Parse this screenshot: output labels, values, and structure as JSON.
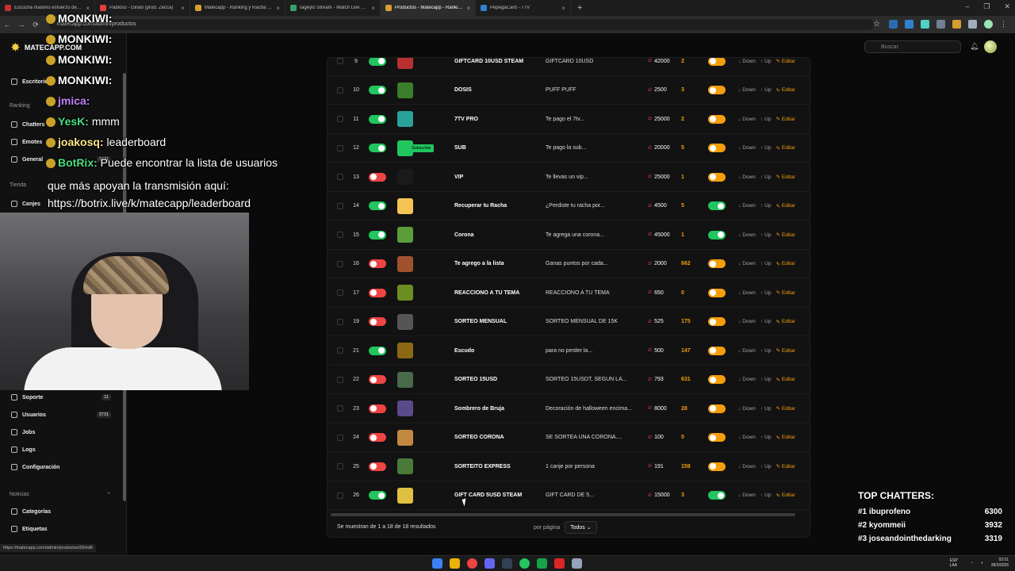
{
  "browser": {
    "tabs": [
      {
        "title": "Escucha maximo esfuerzo de la...",
        "fav": "#c53030",
        "active": false
      },
      {
        "title": "Pabloso - Giralo (prod. Zecca)",
        "fav": "#e53e3e",
        "active": false
      },
      {
        "title": "Matecapp - Ranking y Racha de...",
        "fav": "#d69e2e",
        "active": false
      },
      {
        "title": "rageylo Stream - Watch Live on...",
        "fav": "#38a169",
        "active": false
      },
      {
        "title": "Productos - Matecapp - Ranking...",
        "fav": "#d69e2e",
        "active": true
      },
      {
        "title": "PepegaCard - 7TV",
        "fav": "#3182ce",
        "active": false
      }
    ],
    "new_tab": "+",
    "url": "matecapp.com/admin/productos",
    "window_controls": [
      "–",
      "❐",
      "✕"
    ]
  },
  "sidebar": {
    "logo": "MATECAPP.COM",
    "sections": [
      {
        "label": "Ranking",
        "key": "ranking"
      },
      {
        "label": "Tienda",
        "key": "tienda"
      },
      {
        "label": "Noticias",
        "key": "noticias"
      }
    ],
    "items_top": [
      {
        "label": "Escritorio",
        "badge": ""
      },
      {
        "label": "Chatters",
        "badge": ""
      },
      {
        "label": "Emotes",
        "badge": ""
      },
      {
        "label": "General",
        "badge": "3731"
      },
      {
        "label": "Canjes",
        "badge": ""
      }
    ],
    "items_bottom": [
      {
        "label": "Soporte",
        "badge": "11"
      },
      {
        "label": "Usuarios",
        "badge": "3731"
      },
      {
        "label": "Jobs",
        "badge": ""
      },
      {
        "label": "Logs",
        "badge": ""
      },
      {
        "label": "Configuración",
        "badge": ""
      }
    ],
    "items_news": [
      {
        "label": "Categorías",
        "badge": ""
      },
      {
        "label": "Etiquetas",
        "badge": ""
      }
    ]
  },
  "header": {
    "search_placeholder": "Buscar"
  },
  "table": {
    "rows": [
      {
        "id": "9",
        "active": true,
        "name": "GIFTCARD 10USD STEAM",
        "desc": "GIFTCARD 10USD",
        "cost": "42000",
        "count": "2",
        "visible": false,
        "thumb": "#b83030"
      },
      {
        "id": "10",
        "active": true,
        "name": "DOSIS",
        "desc": "PUFF PUFF",
        "cost": "2500",
        "count": "3",
        "visible": false,
        "thumb": "#3a7d2a"
      },
      {
        "id": "11",
        "active": true,
        "name": "7TV PRO",
        "desc": "Te pago el 7tv...",
        "cost": "25000",
        "count": "2",
        "visible": false,
        "thumb": "#29a39a"
      },
      {
        "id": "12",
        "active": true,
        "name": "SUB",
        "desc": "Te pago la sub...",
        "cost": "20000",
        "count": "5",
        "visible": false,
        "thumb": "#22c55e"
      },
      {
        "id": "13",
        "active": false,
        "name": "VIP",
        "desc": "Te llevas un vip...",
        "cost": "25000",
        "count": "1",
        "visible": false,
        "thumb": "#1a1a1a"
      },
      {
        "id": "14",
        "active": true,
        "name": "Recuperar tu Racha",
        "desc": "¿Perdiste tu racha por...",
        "cost": "4500",
        "count": "5",
        "visible": true,
        "thumb": "#f6c453"
      },
      {
        "id": "15",
        "active": true,
        "name": "Corona",
        "desc": "Te agrega una corona...",
        "cost": "45000",
        "count": "1",
        "visible": true,
        "thumb": "#5a9d3a"
      },
      {
        "id": "16",
        "active": false,
        "name": "Te agrego a la lista",
        "desc": "Ganas puntos por cada...",
        "cost": "2000",
        "count": "662",
        "visible": false,
        "thumb": "#a0522d"
      },
      {
        "id": "17",
        "active": false,
        "name": "REACCIONO A TU TEMA",
        "desc": "REACCIONO A TU TEMA",
        "cost": "650",
        "count": "0",
        "visible": false,
        "thumb": "#6b8e23"
      },
      {
        "id": "19",
        "active": false,
        "name": "SORTEO MENSUAL",
        "desc": "SORTEO MENSUAL DE 15K",
        "cost": "525",
        "count": "175",
        "visible": false,
        "thumb": "#555555"
      },
      {
        "id": "21",
        "active": true,
        "name": "Escudo",
        "desc": "para no perder la...",
        "cost": "500",
        "count": "147",
        "visible": false,
        "thumb": "#8b6914"
      },
      {
        "id": "22",
        "active": false,
        "name": "SORTEO 15USD",
        "desc": "SORTEO 15USDT, SEGUN LA...",
        "cost": "793",
        "count": "631",
        "visible": false,
        "thumb": "#4a6a4a"
      },
      {
        "id": "23",
        "active": false,
        "name": "Sombrero de Bruja",
        "desc": "Decoración de halloween encima...",
        "cost": "8000",
        "count": "28",
        "visible": false,
        "thumb": "#5b4a8a"
      },
      {
        "id": "24",
        "active": false,
        "name": "SORTEO CORONA",
        "desc": "SE SORTEA UNA CORONA....",
        "cost": "100",
        "count": "0",
        "visible": false,
        "thumb": "#c28840"
      },
      {
        "id": "25",
        "active": false,
        "name": "SORTEITO EXPRESS",
        "desc": "1 canje por persona",
        "cost": "191",
        "count": "159",
        "visible": false,
        "thumb": "#4a7a3a"
      },
      {
        "id": "26",
        "active": true,
        "name": "GIFT CARD 5USD STEAM",
        "desc": "GIFT CARD DE 5...",
        "cost": "15000",
        "count": "3",
        "visible": true,
        "thumb": "#e0c040"
      }
    ],
    "action_down": "Down",
    "action_up": "Up",
    "action_edit": "Editar",
    "subscribe_tag": "Subscribe",
    "footer_text": "Se muestran de 1 a 18 de 18 resultados",
    "per_page_label": "por página",
    "per_page_value": "Todos"
  },
  "stream_chat": [
    {
      "user": "MONKIWI:",
      "msg": "",
      "color": "u"
    },
    {
      "user": "MONKIWI:",
      "msg": "",
      "color": "u"
    },
    {
      "user": "MONKIWI:",
      "msg": "",
      "color": "u"
    },
    {
      "user": "MONKIWI:",
      "msg": "",
      "color": "u"
    },
    {
      "user": "jmica:",
      "msg": "",
      "color": "p"
    },
    {
      "user": "YesK:",
      "msg": "mmm",
      "color": "g"
    },
    {
      "user": "joakosq:",
      "msg": "leaderboard",
      "color": "o"
    },
    {
      "user": "BotRix:",
      "msg": "Puede encontrar la lista de usuarios",
      "color": "g"
    }
  ],
  "stream_chat_cont": "que más apoyan la transmisión aquí: https://botrix.live/k/matecapp/leaderboard",
  "top_chatters": {
    "title": "TOP CHATTERS:",
    "rows": [
      {
        "name": "#1 ibuprofeno",
        "score": "6300"
      },
      {
        "name": "#2 kyommeii",
        "score": "3932"
      },
      {
        "name": "#3 joseandointhedarking",
        "score": "3319"
      }
    ]
  },
  "status_url": "https://matecapp.com/admin/productos/26/edit",
  "taskbar": {
    "lang": "ESP LAA",
    "time": "02:01",
    "date": "28/3/2026"
  },
  "colors": {
    "toggle_on": "#22c55e",
    "toggle_off": "#ef4444",
    "accent": "#f59e0b"
  }
}
